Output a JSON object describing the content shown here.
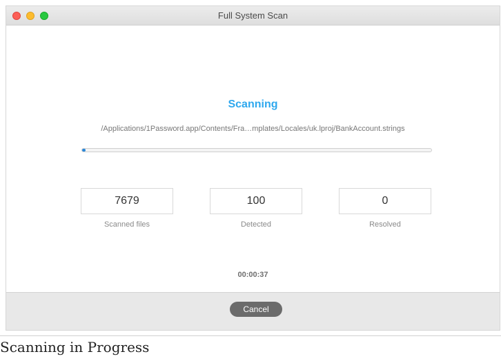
{
  "window": {
    "title": "Full System Scan"
  },
  "scan": {
    "heading": "Scanning",
    "current_path": "/Applications/1Password.app/Contents/Fra…mplates/Locales/uk.lproj/BankAccount.strings",
    "progress_fraction": 0.01,
    "elapsed": "00:00:37"
  },
  "stats": [
    {
      "value": "7679",
      "label": "Scanned files"
    },
    {
      "value": "100",
      "label": "Detected"
    },
    {
      "value": "0",
      "label": "Resolved"
    }
  ],
  "footer": {
    "cancel_label": "Cancel"
  },
  "caption": "Scanning in Progress",
  "colors": {
    "accent": "#2ea8ee",
    "progress": "#2a87d8",
    "button": "#6b6b6b"
  },
  "icons": {
    "close": "close-window-icon",
    "minimize": "minimize-window-icon",
    "maximize": "maximize-window-icon"
  }
}
